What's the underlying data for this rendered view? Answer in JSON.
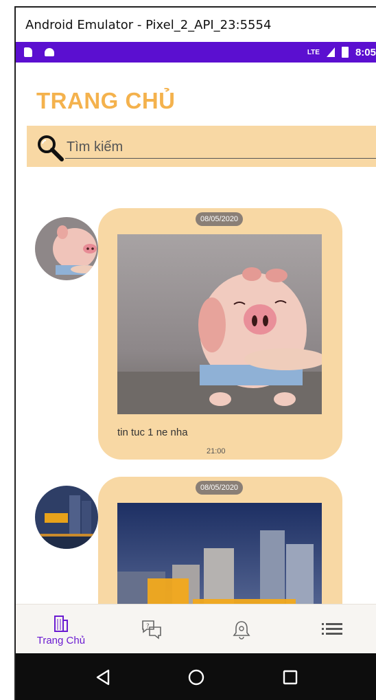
{
  "window": {
    "title": "Android Emulator - Pixel_2_API_23:5554"
  },
  "status_bar": {
    "network": "LTE",
    "time": "8:05"
  },
  "header": {
    "title": "TRANG CHỦ"
  },
  "search": {
    "placeholder": "Tìm kiếm"
  },
  "feed": {
    "posts": [
      {
        "date": "08/05/2020",
        "text": "tin tuc 1 ne nha",
        "time": "21:00",
        "avatar_icon": "pig-avatar-icon",
        "image_icon": "pig-photo-icon"
      },
      {
        "date": "08/05/2020",
        "avatar_icon": "haven-logo-avatar-icon",
        "image_icon": "city-buildings-photo-icon"
      }
    ]
  },
  "bottom_nav": {
    "items": [
      {
        "label": "Trang Chủ",
        "icon": "building-icon",
        "active": true
      },
      {
        "label": "",
        "icon": "chat-question-icon",
        "active": false
      },
      {
        "label": "",
        "icon": "bell-icon",
        "active": false
      },
      {
        "label": "",
        "icon": "menu-list-icon",
        "active": false
      }
    ]
  },
  "colors": {
    "accent": "#f4b24d",
    "peach": "#f8d8a4",
    "status_bar": "#5b0fd0",
    "nav_active": "#6a1bd1"
  }
}
